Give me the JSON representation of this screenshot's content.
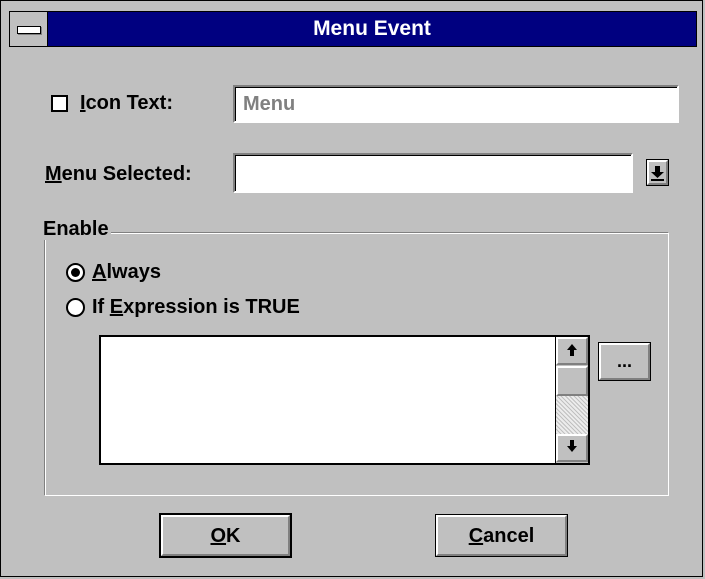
{
  "window": {
    "title": "Menu Event"
  },
  "icon_text": {
    "label_pre": "",
    "label_mnemonic": "I",
    "label_post": "con Text:",
    "checked": false,
    "value": "Menu"
  },
  "menu_selected": {
    "label_mnemonic": "M",
    "label_post": "enu Selected:",
    "value": "",
    "dropdown_icon": "arrow-down-icon"
  },
  "enable_group": {
    "legend": "Enable",
    "options": [
      {
        "pre": "",
        "mnemonic": "A",
        "post": "lways",
        "selected": true
      },
      {
        "pre": "If ",
        "mnemonic": "E",
        "post": "xpression is TRUE",
        "selected": false
      }
    ],
    "expression_text": "",
    "ellipsis_label": "..."
  },
  "buttons": {
    "ok": {
      "mnemonic": "O",
      "post": "K"
    },
    "cancel": {
      "mnemonic": "C",
      "post": "ancel"
    }
  },
  "colors": {
    "titlebar": "#000080",
    "face": "#c0c0c0",
    "disabled_text": "#808080"
  }
}
